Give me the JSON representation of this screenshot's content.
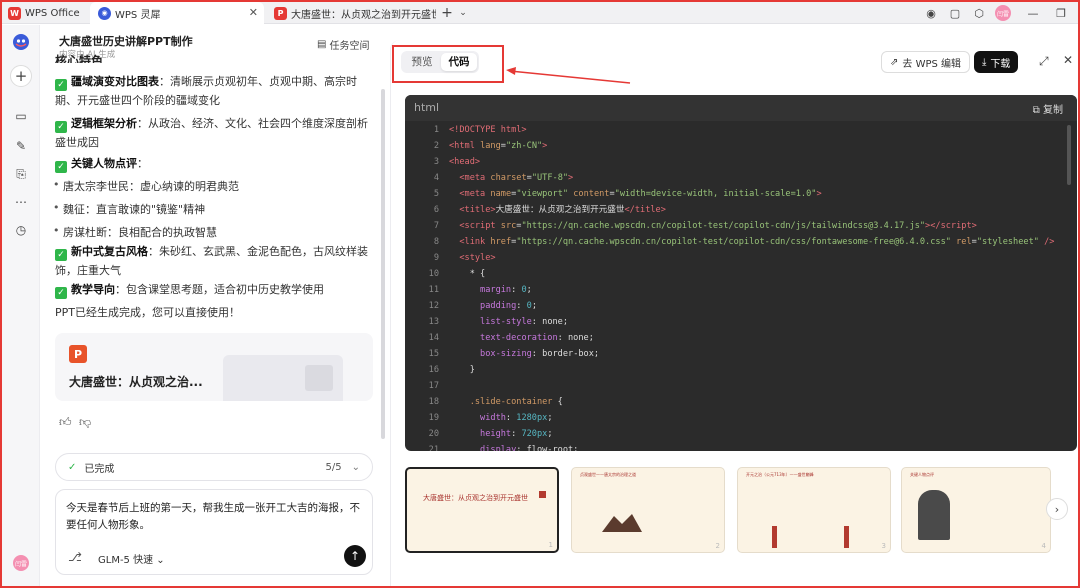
{
  "tabs": [
    {
      "label": "WPS Office",
      "icon": "W"
    },
    {
      "label": "WPS 灵犀",
      "icon": "◉"
    },
    {
      "label": "大唐盛世：从贞观之治到开元盛世",
      "icon": "P"
    }
  ],
  "window": {
    "avatar": "闫雷"
  },
  "chat": {
    "title": "大唐盛世历史讲解PPT制作",
    "subtitle": "内容由 AI 生成",
    "workspace": "任务空间",
    "cut_heading": "核心特色",
    "features": [
      {
        "title": "疆域演变对比图表",
        "desc": "：清晰展示贞观初年、贞观中期、高宗时期、开元盛世四个阶段的疆域变化"
      },
      {
        "title": "逻辑框架分析",
        "desc": "：从政治、经济、文化、社会四个维度深度剖析盛世成因"
      },
      {
        "title": "关键人物点评",
        "desc": "："
      }
    ],
    "people": [
      "唐太宗李世民：虚心纳谏的明君典范",
      "魏征：直言敢谏的\"镜鉴\"精神",
      "房谋杜断：良相配合的执政智慧"
    ],
    "features2": [
      {
        "title": "新中式复古风格",
        "desc": "：朱砂红、玄武黑、金泥色配色，古风纹样装饰，庄重大气"
      },
      {
        "title": "教学导向",
        "desc": "：包含课堂思考题，适合初中历史教学使用"
      }
    ],
    "done_note": "PPT已经生成完成，您可以直接使用！",
    "card_title": "大唐盛世：从贞观之治...",
    "status_label": "已完成",
    "status_count": "5/5",
    "input_text": "今天是春节后上班的第一天，帮我生成一张开工大吉的海报，不要任何人物形象。",
    "model": "GLM-5 快速"
  },
  "preview": {
    "tab_preview": "预览",
    "tab_code": "代码",
    "wps_edit": "去 WPS 编辑",
    "download": "下载",
    "code_lang": "html",
    "copy": "复制",
    "code_lines": [
      {
        "n": "1",
        "html": "<span class='tg'>&lt;!DOCTYPE html&gt;</span>"
      },
      {
        "n": "2",
        "html": "<span class='tg'>&lt;html</span> <span class='at'>lang</span>=<span class='st'>\"zh-CN\"</span><span class='tg'>&gt;</span>"
      },
      {
        "n": "3",
        "html": "<span class='tg'>&lt;head&gt;</span>"
      },
      {
        "n": "4",
        "html": "  <span class='tg'>&lt;meta</span> <span class='at'>charset</span>=<span class='st'>\"UTF-8\"</span><span class='tg'>&gt;</span>"
      },
      {
        "n": "5",
        "html": "  <span class='tg'>&lt;meta</span> <span class='at'>name</span>=<span class='st'>\"viewport\"</span> <span class='at'>content</span>=<span class='st'>\"width=device-width, initial-scale=1.0\"</span><span class='tg'>&gt;</span>"
      },
      {
        "n": "6",
        "html": "  <span class='tg'>&lt;title&gt;</span>大唐盛世：从贞观之治到开元盛世<span class='tg'>&lt;/title&gt;</span>"
      },
      {
        "n": "7",
        "html": "  <span class='tg'>&lt;script</span> <span class='at'>src</span>=<span class='st'>\"https://qn.cache.wpscdn.cn/copilot-test/copilot-cdn/js/tailwindcss@3.4.17.js\"</span><span class='tg'>&gt;&lt;/script&gt;</span>"
      },
      {
        "n": "8",
        "html": "  <span class='tg'>&lt;link</span> <span class='at'>href</span>=<span class='st'>\"https://qn.cache.wpscdn.cn/copilot-test/copilot-cdn/css/fontawesome-free@6.4.0.css\"</span> <span class='at'>rel</span>=<span class='st'>\"stylesheet\"</span> <span class='tg'>/&gt;</span>"
      },
      {
        "n": "9",
        "html": "  <span class='tg'>&lt;style&gt;</span>"
      },
      {
        "n": "10",
        "html": "    * {"
      },
      {
        "n": "11",
        "html": "      <span class='pr'>margin</span>: <span class='vl'>0</span>;"
      },
      {
        "n": "12",
        "html": "      <span class='pr'>padding</span>: <span class='vl'>0</span>;"
      },
      {
        "n": "13",
        "html": "      <span class='pr'>list-style</span>: none;"
      },
      {
        "n": "14",
        "html": "      <span class='pr'>text-decoration</span>: none;"
      },
      {
        "n": "15",
        "html": "      <span class='pr'>box-sizing</span>: border-box;"
      },
      {
        "n": "16",
        "html": "    }"
      },
      {
        "n": "17",
        "html": ""
      },
      {
        "n": "18",
        "html": "    <span class='at'>.slide-container</span> {"
      },
      {
        "n": "19",
        "html": "      <span class='pr'>width</span>: <span class='vl'>1280px</span>;"
      },
      {
        "n": "20",
        "html": "      <span class='pr'>height</span>: <span class='vl'>720px</span>;"
      },
      {
        "n": "21",
        "html": "      <span class='pr'>display</span>: flow-root;"
      }
    ],
    "thumbs": [
      {
        "title": "大唐盛世：从贞观之治到开元盛世",
        "page": "1"
      },
      {
        "title": "贞观盛世——唐太宗的治理之道",
        "page": "2"
      },
      {
        "title": "开元之治（公元713年）——盛世巅峰",
        "page": "3"
      },
      {
        "title": "关键人物点评",
        "page": "4"
      }
    ]
  },
  "colors": {
    "accent": "#e53935",
    "check": "#2fb64a",
    "code_bg": "#2b2b2b"
  }
}
